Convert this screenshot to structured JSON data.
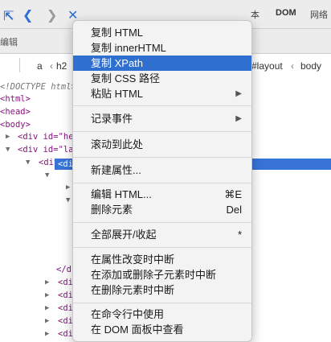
{
  "toolbar": {
    "tabs_row1": [
      "本",
      "DOM",
      "网络"
    ],
    "tabs_row2_left": "编辑",
    "breadcrumbs": [
      "a",
      "h2",
      "#layout",
      "body"
    ]
  },
  "tree": {
    "doctype": "<!DOCTYPE html>",
    "lines": {
      "html": "<html>",
      "head": "<head>",
      "body": "<body>",
      "div_he": "<div id=\"he",
      "div_la": "<div id=\"la",
      "div_id": "<div id",
      "div_sel": "<di",
      "close_div": "</d",
      "di": "<di"
    }
  },
  "context_menu": {
    "copy_html": "复制 HTML",
    "copy_inner_html": "复制 innerHTML",
    "copy_xpath": "复制 XPath",
    "copy_css_path": "复制 CSS 路径",
    "paste_html": "粘贴 HTML",
    "log_event": "记录事件",
    "scroll_into_view": "滚动到此处",
    "new_attribute": "新建属性...",
    "edit_html": "编辑 HTML...",
    "edit_html_shortcut": "⌘E",
    "delete_element": "删除元素",
    "delete_shortcut": "Del",
    "expand_collapse_all": "全部展开/收起",
    "expand_shortcut": "*",
    "break_attr_change": "在属性改变时中断",
    "break_child_change": "在添加或删除子元素时中断",
    "break_removal": "在删除元素时中断",
    "use_in_console": "在命令行中使用",
    "view_in_dom": "在 DOM 面板中查看"
  }
}
